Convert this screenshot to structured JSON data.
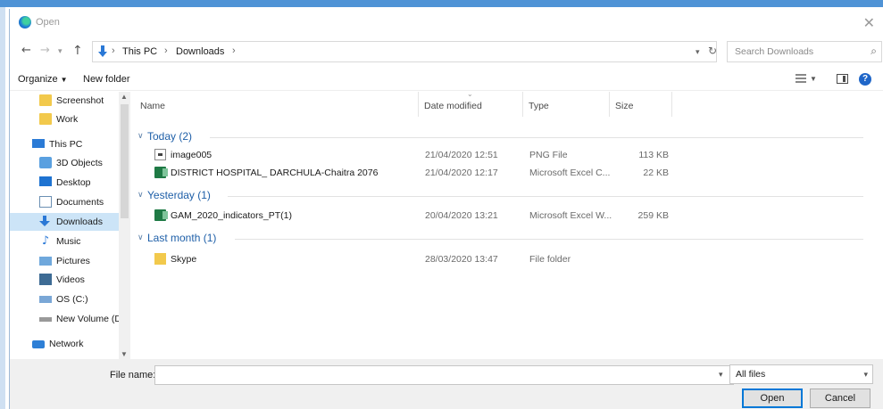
{
  "window": {
    "title": "Open",
    "close_glyph": "✕"
  },
  "address": {
    "crumbs": [
      "This PC",
      "Downloads"
    ],
    "separator": "›",
    "search_placeholder": "Search Downloads"
  },
  "toolbar": {
    "organize": "Organize",
    "new_folder": "New folder"
  },
  "nav": {
    "items": [
      {
        "label": "Screenshot",
        "icon": "folder-icon"
      },
      {
        "label": "Work",
        "icon": "folder-icon"
      },
      {
        "label": "This PC",
        "icon": "computer-icon"
      },
      {
        "label": "3D Objects",
        "icon": "3d-objects-icon"
      },
      {
        "label": "Desktop",
        "icon": "desktop-icon"
      },
      {
        "label": "Documents",
        "icon": "documents-icon"
      },
      {
        "label": "Downloads",
        "icon": "downloads-icon",
        "selected": true
      },
      {
        "label": "Music",
        "icon": "music-icon"
      },
      {
        "label": "Pictures",
        "icon": "pictures-icon"
      },
      {
        "label": "Videos",
        "icon": "videos-icon"
      },
      {
        "label": "OS (C:)",
        "icon": "drive-icon"
      },
      {
        "label": "New Volume (D:",
        "icon": "drive-icon"
      },
      {
        "label": "Network",
        "icon": "network-icon"
      }
    ]
  },
  "columns": {
    "name": "Name",
    "date": "Date modified",
    "type": "Type",
    "size": "Size"
  },
  "groups": [
    {
      "label": "Today (2)",
      "files": [
        {
          "name": "image005",
          "date": "21/04/2020 12:51",
          "type": "PNG File",
          "size": "113 KB",
          "icon": "image-file-icon"
        },
        {
          "name": "DISTRICT HOSPITAL_ DARCHULA-Chaitra 2076",
          "date": "21/04/2020 12:17",
          "type": "Microsoft Excel C...",
          "size": "22 KB",
          "icon": "excel-file-icon"
        }
      ]
    },
    {
      "label": "Yesterday (1)",
      "files": [
        {
          "name": "GAM_2020_indicators_PT(1)",
          "date": "20/04/2020 13:21",
          "type": "Microsoft Excel W...",
          "size": "259 KB",
          "icon": "excel-file-icon"
        }
      ]
    },
    {
      "label": "Last month (1)",
      "files": [
        {
          "name": "Skype",
          "date": "28/03/2020 13:47",
          "type": "File folder",
          "size": "",
          "icon": "folder-icon"
        }
      ]
    }
  ],
  "footer": {
    "file_name_label": "File name:",
    "file_name_value": "",
    "filter": "All files",
    "open": "Open",
    "cancel": "Cancel"
  }
}
